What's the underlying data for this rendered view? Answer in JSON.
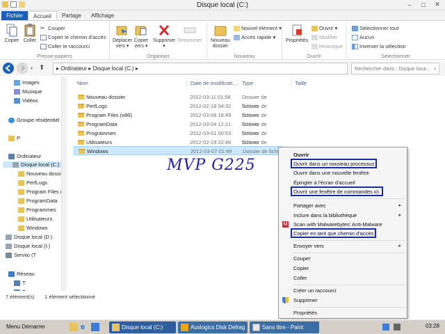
{
  "window": {
    "title": "Disque local (C:)",
    "controls": [
      "–",
      "□",
      "✕"
    ]
  },
  "tabs": [
    {
      "label": "Fichier"
    },
    {
      "label": "Accueil"
    },
    {
      "label": "Partage"
    },
    {
      "label": "Affichage"
    }
  ],
  "ribbon": {
    "presse_papiers": {
      "label": "Presse-papiers",
      "copier": "Copier",
      "coller": "Coller",
      "couper": "Couper",
      "copier_chemin": "Copier le chemin d'accès",
      "coller_raccourci": "Coller le raccourci"
    },
    "organiser": {
      "label": "Organiser",
      "deplacer": "Déplacer vers ▾",
      "copier_vers": "Copier vers ▾",
      "supprimer": "Supprimer ▾",
      "renommer": "Renommer"
    },
    "nouveau": {
      "label": "Nouveau",
      "nouveau_dossier": "Nouveau dossier",
      "nouvel_element": "Nouvel élément ▾",
      "acces_rapide": "Accès rapide ▾"
    },
    "ouvrir": {
      "label": "Ouvrir",
      "proprietes": "Propriétés",
      "ouvrir": "Ouvrir ▾",
      "modifier": "Modifier",
      "historique": "Historique"
    },
    "selectionner": {
      "label": "Sélectionner",
      "tout": "Sélectionner tout",
      "aucun": "Aucun",
      "inverser": "Inverser la sélection"
    }
  },
  "address": {
    "path": "▸ Ordinateur  ▸ Disque local (C:)  ▸",
    "search_placeholder": "Rechercher dans : Disque loca..."
  },
  "nav": [
    {
      "label": "Images"
    },
    {
      "label": "Musique"
    },
    {
      "label": "Vidéos"
    },
    {
      "label": "Groupe résidentiel"
    },
    {
      "label": "P"
    },
    {
      "label": "Ordinateur"
    },
    {
      "label": "Disque local (C:)"
    },
    {
      "label": "Nouveau dossi"
    },
    {
      "label": "PerfLogs"
    },
    {
      "label": "Program Files ("
    },
    {
      "label": "ProgramData"
    },
    {
      "label": "Programmes"
    },
    {
      "label": "Utilisateurs"
    },
    {
      "label": "Windows"
    },
    {
      "label": "Disque local (D:)"
    },
    {
      "label": "Disque local (I:)"
    },
    {
      "label": "Serviio (T"
    },
    {
      "label": "Réseau"
    },
    {
      "label": "T"
    },
    {
      "label": "T"
    }
  ],
  "columns": {
    "nom": "Nom",
    "date": "Date de modificati...",
    "type": "Type",
    "taille": "Taille"
  },
  "files": [
    {
      "name": "Nouveau dossier",
      "date": "2012-03-11 01:58",
      "type": "Dossier de fichiers"
    },
    {
      "name": "PerfLogs",
      "date": "2012-02-18 04:32",
      "type": "Dossier de fichiers"
    },
    {
      "name": "Program Files (x86)",
      "date": "2012-03-06 18:49",
      "type": "Dossier de fichiers"
    },
    {
      "name": "ProgramData",
      "date": "2012-03-04 12:21",
      "type": "Dossier de fichiers"
    },
    {
      "name": "Programmes",
      "date": "2012-03-01 00:53",
      "type": "Dossier de fichiers"
    },
    {
      "name": "Utilisateurs",
      "date": "2012-02-29 22:46",
      "type": "Dossier de fichiers"
    },
    {
      "name": "Windows",
      "date": "2012-03-07 01:49",
      "type": "Dossier de fichi"
    }
  ],
  "status": {
    "count": "7 élément(s)",
    "selected": "1 élément sélectionné"
  },
  "watermark": "MVP G225",
  "context_menu": {
    "items": [
      {
        "label": "Ouvrir"
      },
      {
        "label": "Ouvrir dans un nouveau processus"
      },
      {
        "label": "Ouvrir dans une nouvelle fenêtre"
      },
      {
        "label": "Épingler à l'écran d'accueil"
      },
      {
        "label": "Ouvrir une fenêtre de commandes ici"
      },
      {
        "label": "Partager avec"
      },
      {
        "label": "Inclure dans la bibliothèque"
      },
      {
        "label": "Scan with Malwarebytes' Anti-Malware"
      },
      {
        "label": "Copier en tant que chemin d'accès"
      },
      {
        "label": "Envoyer vers"
      },
      {
        "label": "Couper"
      },
      {
        "label": "Copier"
      },
      {
        "label": "Coller"
      },
      {
        "label": "Créer un raccourci"
      },
      {
        "label": "Supprimer"
      },
      {
        "label": "Propriétés"
      }
    ],
    "submenu_arrow": "▸"
  },
  "taskbar": {
    "start": "Menu Démarrer",
    "tasks": [
      {
        "label": "Disque local (C:)"
      },
      {
        "label": "Auslogics Disk Defrag"
      },
      {
        "label": "Sans titre - Paint"
      }
    ],
    "clock": "03:28"
  },
  "colors": {
    "file_tab": "#1c5fb6",
    "selection": "#cce8ff",
    "highlight_box": "#1b2ba6",
    "watermark": "#1f1fa8",
    "taskbar_task": "#3a6ea5",
    "folder": "#e8c35a"
  }
}
